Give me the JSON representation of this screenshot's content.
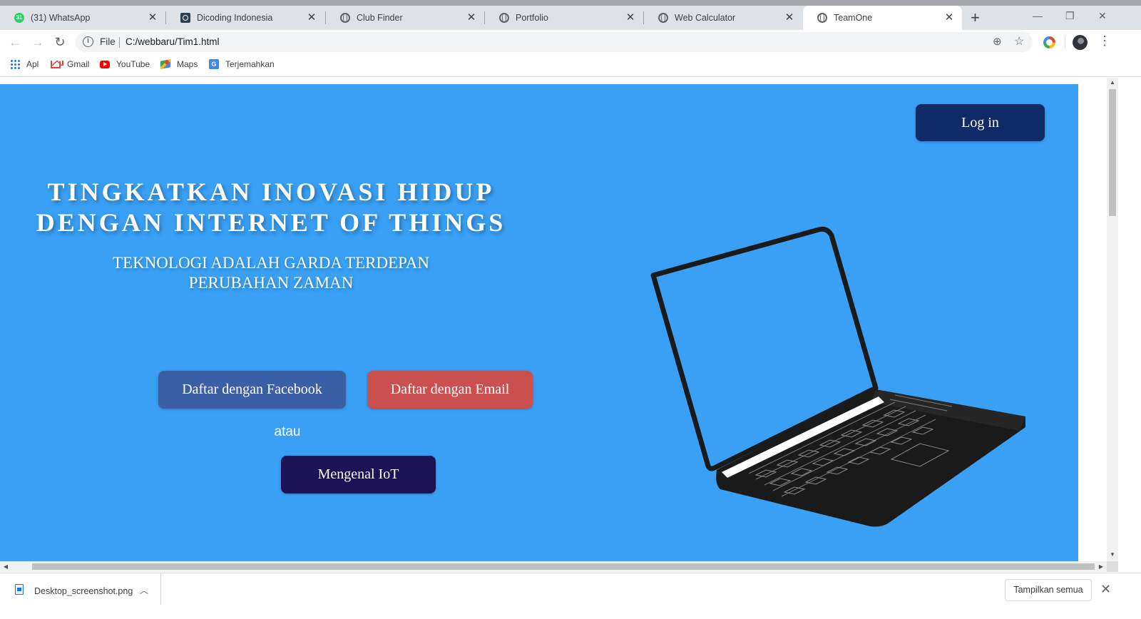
{
  "browser": {
    "tabs": [
      {
        "title": "(31) WhatsApp",
        "favicon": "whatsapp-icon",
        "active": false
      },
      {
        "title": "Dicoding Indonesia",
        "favicon": "dicoding-icon",
        "active": false
      },
      {
        "title": "Club Finder",
        "favicon": "globe-icon",
        "active": false
      },
      {
        "title": "Portfolio",
        "favicon": "globe-icon",
        "active": false
      },
      {
        "title": "Web Calculator",
        "favicon": "globe-icon",
        "active": false
      },
      {
        "title": "TeamOne",
        "favicon": "globe-icon",
        "active": true
      }
    ],
    "whatsapp_badge": "31",
    "address": {
      "scheme_label": "File",
      "url": "C:/webbaru/Tim1.html"
    },
    "bookmarks": [
      {
        "label": "Apl",
        "icon": "apps-grid-icon"
      },
      {
        "label": "Gmail",
        "icon": "gmail-icon"
      },
      {
        "label": "YouTube",
        "icon": "youtube-icon"
      },
      {
        "label": "Maps",
        "icon": "maps-icon"
      },
      {
        "label": "Terjemahkan",
        "icon": "translate-icon"
      }
    ]
  },
  "page": {
    "background_color": "#39a0f5",
    "login_label": "Log in",
    "title_line1": "TINGKATKAN INOVASI HIDUP",
    "title_line2": "DENGAN INTERNET OF THINGS",
    "subtitle_line1": "TEKNOLOGI ADALAH GARDA TERDEPAN",
    "subtitle_line2": "PERUBAHAN ZAMAN",
    "facebook_label": "Daftar dengan Facebook",
    "email_label": "Daftar dengan Email",
    "or_label": "atau",
    "learn_iot_label": "Mengenal IoT",
    "hero_image": "laptop-illustration",
    "colors": {
      "login": "#0f2a66",
      "facebook": "#3b5fa4",
      "email": "#c9504f",
      "iot": "#1c1357"
    }
  },
  "downloads": {
    "file_name": "Desktop_screenshot.png",
    "show_all_label": "Tampilkan semua"
  }
}
